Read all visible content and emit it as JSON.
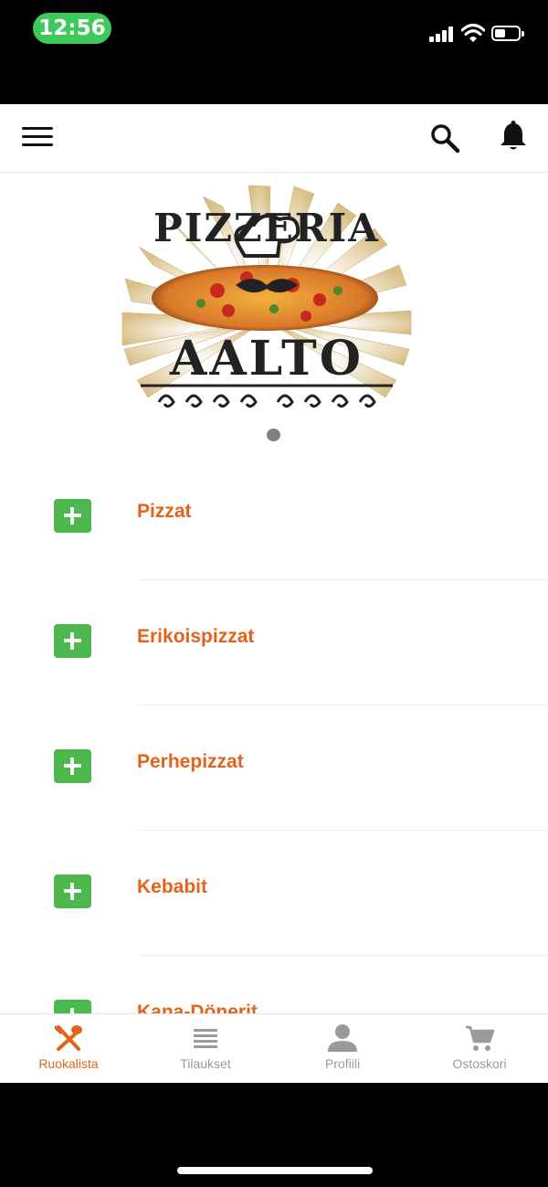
{
  "status_bar": {
    "time": "12:56"
  },
  "header": {
    "menu_icon": "hamburger-icon",
    "search_icon": "search-icon",
    "notification_icon": "bell-icon"
  },
  "logo": {
    "top_text": "PIZZERIA",
    "bottom_text": "AALTO"
  },
  "carousel": {
    "dots": 1
  },
  "categories": [
    {
      "label": "Pizzat"
    },
    {
      "label": "Erikoispizzat"
    },
    {
      "label": "Perhepizzat"
    },
    {
      "label": "Kebabit"
    },
    {
      "label": "Kana-Dönerit"
    }
  ],
  "tabs": [
    {
      "label": "Ruokalista",
      "icon": "fork-spoon-icon",
      "active": true
    },
    {
      "label": "Tilaukset",
      "icon": "list-icon",
      "active": false
    },
    {
      "label": "Profiili",
      "icon": "person-icon",
      "active": false
    },
    {
      "label": "Ostoskori",
      "icon": "cart-icon",
      "active": false
    }
  ],
  "colors": {
    "accent": "#e5621b",
    "add_button": "#4cb84d",
    "status_pill": "#3ec95c",
    "tab_inactive": "#9a9a9a"
  }
}
